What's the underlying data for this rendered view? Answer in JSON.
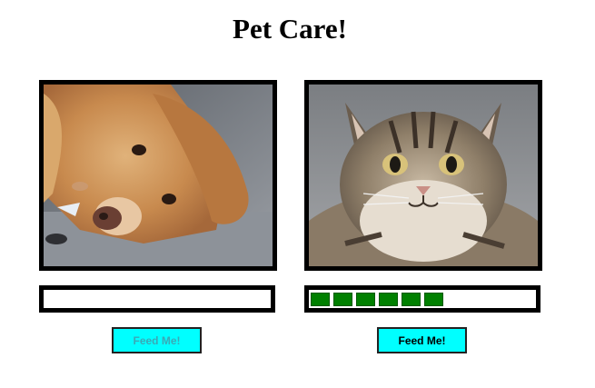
{
  "page": {
    "title": "Pet Care!"
  },
  "pets": [
    {
      "animal": "dog",
      "photo_description_icon": "golden-retriever-photo",
      "food_level_segments": 0,
      "food_level_max": 10,
      "button_label": "Feed Me!",
      "button_state": "disabled",
      "button_text_color": "#3aa9b6"
    },
    {
      "animal": "cat",
      "photo_description_icon": "maine-coon-cat-photo",
      "food_level_segments": 6,
      "food_level_max": 10,
      "button_label": "Feed Me!",
      "button_state": "enabled",
      "button_text_color": "#000000"
    }
  ],
  "colors": {
    "button_bg": "#00ffff",
    "meter_fill": "#008000",
    "frame_border": "#000000"
  }
}
